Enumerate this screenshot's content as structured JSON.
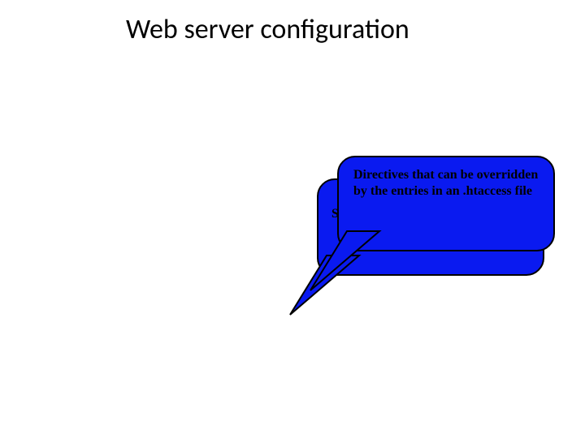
{
  "title": "Web server configuration",
  "callouts": {
    "front": {
      "text": "Directives that can be overridden by the entries in an .htaccess file"
    },
    "back": {
      "visible_text_fragment": "Se"
    }
  },
  "colors": {
    "bubble_fill": "#0a1af0",
    "bubble_stroke": "#000000"
  }
}
